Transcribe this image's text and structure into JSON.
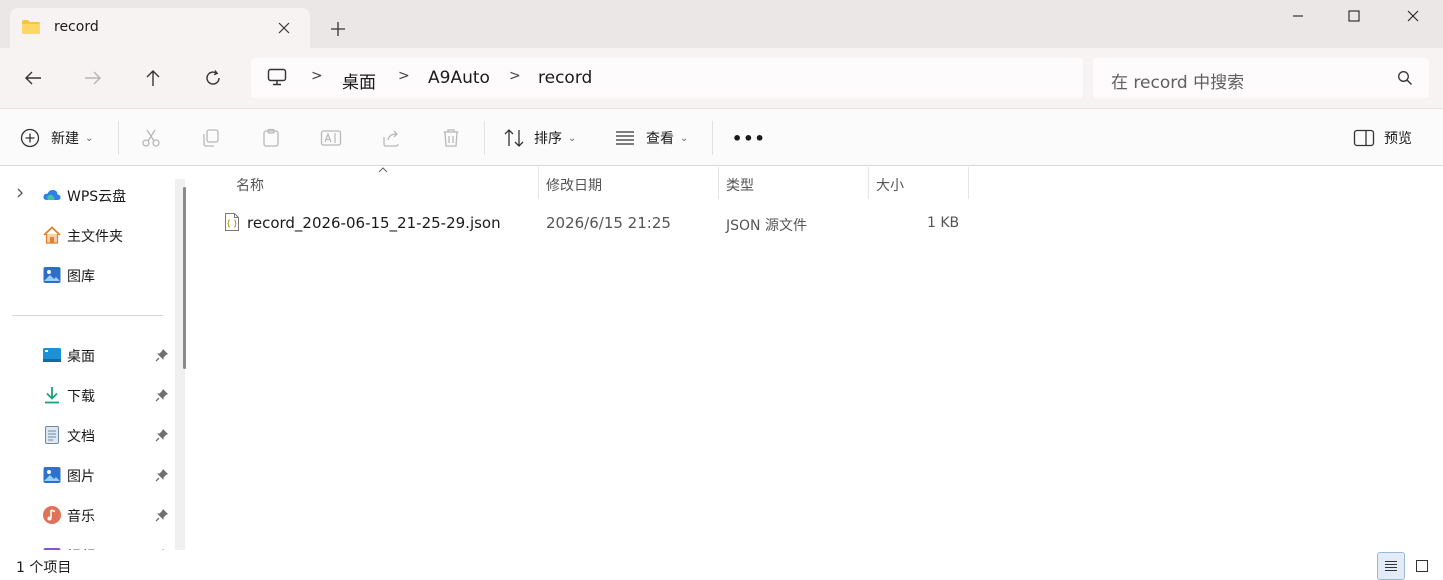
{
  "window": {
    "tab_title": "record",
    "tab_icon": "folder-icon",
    "controls": [
      "minimize-icon",
      "maximize-icon",
      "close-icon"
    ]
  },
  "nav": {
    "buttons": [
      "back-arrow-icon",
      "forward-arrow-icon",
      "up-arrow-icon",
      "refresh-icon"
    ],
    "breadcrumb": [
      "桌面",
      "A9Auto",
      "record"
    ],
    "search_placeholder": "在 record 中搜索"
  },
  "toolbar": {
    "new_label": "新建",
    "sort_label": "排序",
    "view_label": "查看",
    "more_label": "•••",
    "details_label": "预览",
    "icons": [
      "cut-icon",
      "copy-icon",
      "paste-icon",
      "rename-icon",
      "share-icon",
      "delete-icon"
    ]
  },
  "sidebar": {
    "items": [
      {
        "label": "WPS云盘",
        "icon": "cloud-icon",
        "pinned": false
      },
      {
        "label": "主文件夹",
        "icon": "home-icon",
        "pinned": false
      },
      {
        "label": "图库",
        "icon": "gallery-icon",
        "pinned": false
      },
      {
        "label": "桌面",
        "icon": "desktop-icon",
        "pinned": true
      },
      {
        "label": "下载",
        "icon": "download-icon",
        "pinned": true
      },
      {
        "label": "文档",
        "icon": "document-icon",
        "pinned": true
      },
      {
        "label": "图片",
        "icon": "pictures-icon",
        "pinned": true
      },
      {
        "label": "音乐",
        "icon": "music-icon",
        "pinned": true
      },
      {
        "label": "视频",
        "icon": "video-icon",
        "pinned": true
      }
    ]
  },
  "files": {
    "columns": [
      "名称",
      "修改日期",
      "类型",
      "大小"
    ],
    "rows": [
      {
        "name": "record_2026-06-15_21-25-29.json",
        "modified": "2026/6/15 21:25",
        "type": "JSON 源文件",
        "size": "1 KB"
      }
    ]
  },
  "status": {
    "count_text": "1 个项目"
  },
  "colors": {
    "titlebar": "#ece7e7",
    "navbar": "#f7f3f3",
    "accent": "#0067c0"
  }
}
